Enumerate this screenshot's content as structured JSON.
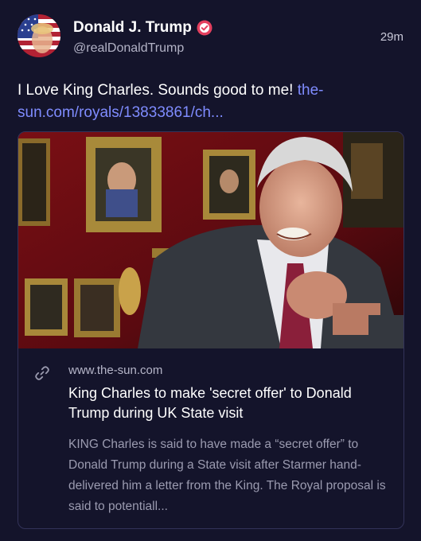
{
  "author": {
    "display_name": "Donald J. Trump",
    "handle": "@realDonaldTrump",
    "verified": true,
    "timestamp": "29m"
  },
  "post": {
    "text": "I Love King Charles. Sounds good to me! ",
    "link_text": "the-sun.com/royals/13833861/ch..."
  },
  "link_card": {
    "domain": "www.the-sun.com",
    "title": "King Charles to make 'secret offer' to Donald Trump during UK State visit",
    "description": "KING Charles is said to have made a “secret offer” to Donald Trump during a State visit after Starmer hand-delivered him a letter from the King. The Royal proposal is said to potentiall..."
  },
  "icons": {
    "verified": "verified-badge-icon",
    "link": "link-chain-icon"
  },
  "colors": {
    "background": "#14142b",
    "link": "#7f8cff",
    "verified_badge": "#e4405f",
    "muted_text": "#9b9bb0"
  }
}
